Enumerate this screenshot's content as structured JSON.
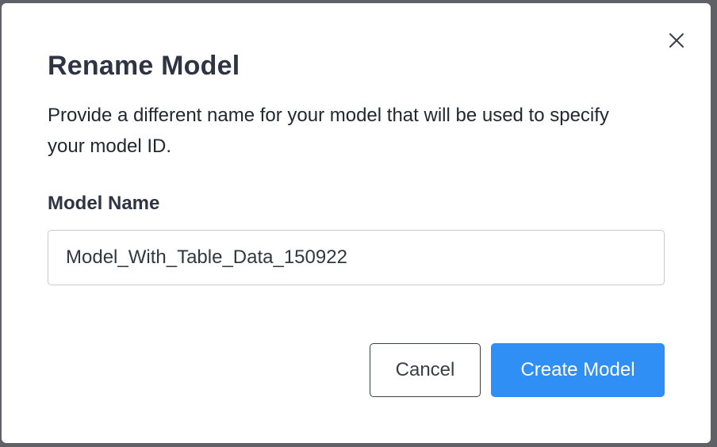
{
  "dialog": {
    "title": "Rename Model",
    "description": "Provide a different name for your model that will be used to specify your model ID.",
    "field_label": "Model Name",
    "field_value": "Model_With_Table_Data_150922",
    "close_icon": "close-icon",
    "cancel_label": "Cancel",
    "create_label": "Create Model"
  },
  "colors": {
    "primary": "#2f8ff5",
    "title": "#2f3444",
    "backdrop": "#5f6166"
  }
}
